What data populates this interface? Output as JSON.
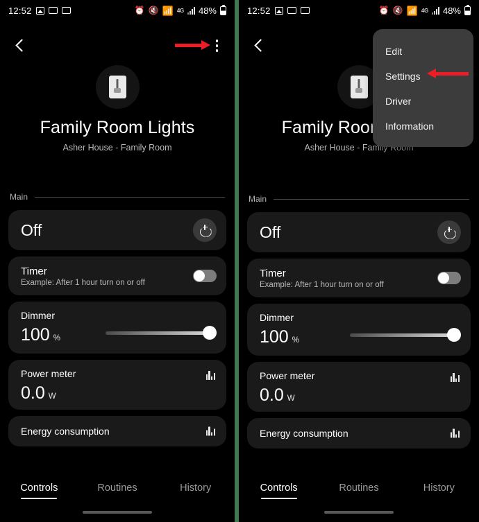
{
  "status_bar": {
    "time": "12:52",
    "battery_percent": "48%",
    "network_type": "4G",
    "icons": [
      "gallery-icon",
      "screen-cast-icon",
      "screen-cast-icon",
      "alarm-icon",
      "mute-icon",
      "wifi-icon",
      "network-4g-icon",
      "signal-bars-icon",
      "battery-icon"
    ]
  },
  "nav": {
    "back_label": "Back",
    "overflow_label": "More options"
  },
  "device": {
    "icon": "light-switch-icon",
    "title": "Family Room Lights",
    "subtitle": "Asher House - Family Room"
  },
  "section": {
    "label": "Main"
  },
  "cards": {
    "onoff": {
      "state": "Off",
      "power_button": "power-icon"
    },
    "timer": {
      "title": "Timer",
      "description": "Example: After 1 hour turn on or off",
      "toggle_state": "off"
    },
    "dimmer": {
      "title": "Dimmer",
      "value": "100",
      "unit": "%",
      "slider_percent": 100
    },
    "power_meter": {
      "title": "Power meter",
      "value": "0.0",
      "unit": "W",
      "chart_icon": "bar-chart-icon"
    },
    "energy": {
      "title": "Energy consumption",
      "chart_icon": "bar-chart-icon"
    }
  },
  "tabs": [
    {
      "label": "Controls",
      "active": true
    },
    {
      "label": "Routines",
      "active": false
    },
    {
      "label": "History",
      "active": false
    }
  ],
  "menu": {
    "items": [
      {
        "label": "Edit"
      },
      {
        "label": "Settings"
      },
      {
        "label": "Driver"
      },
      {
        "label": "Information"
      }
    ]
  },
  "annotations": {
    "arrow_to_kebab": "arrow-pointing-to-overflow-menu",
    "arrow_to_settings": "arrow-pointing-to-settings-item"
  },
  "colors": {
    "background": "#000000",
    "card": "#1a1a1a",
    "menu": "#3c3c3c",
    "accent_red": "#ee1c25",
    "divider_green": "#43774f"
  }
}
